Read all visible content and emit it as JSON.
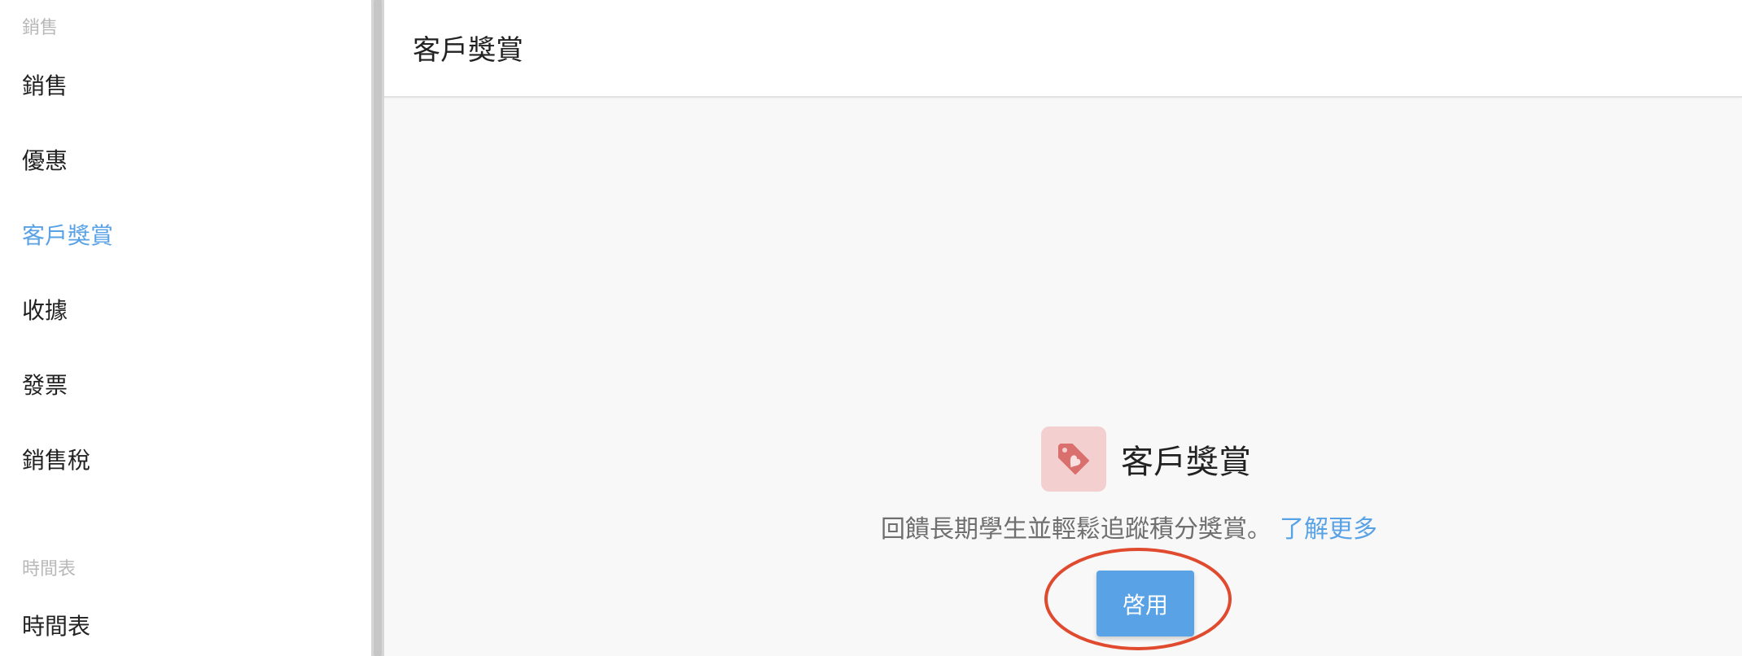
{
  "sidebar": {
    "sections": [
      {
        "header": "銷售",
        "items": [
          {
            "label": "銷售",
            "active": false
          },
          {
            "label": "優惠",
            "active": false
          },
          {
            "label": "客戶獎賞",
            "active": true
          },
          {
            "label": "收據",
            "active": false
          },
          {
            "label": "發票",
            "active": false
          },
          {
            "label": "銷售稅",
            "active": false
          }
        ]
      },
      {
        "header": "時間表",
        "items": [
          {
            "label": "時間表",
            "active": false
          }
        ]
      }
    ]
  },
  "main": {
    "title": "客戶獎賞",
    "feature": {
      "icon": "heart-tag-icon",
      "title": "客戶獎賞",
      "description": "回饋長期學生並輕鬆追蹤積分獎賞。",
      "learn_more_label": "了解更多",
      "enable_button_label": "啓用"
    }
  },
  "colors": {
    "accent": "#5aa2e6",
    "icon_bg": "#f3d0cf",
    "icon_fg": "#d9706e",
    "annotation": "#e04a2f"
  }
}
